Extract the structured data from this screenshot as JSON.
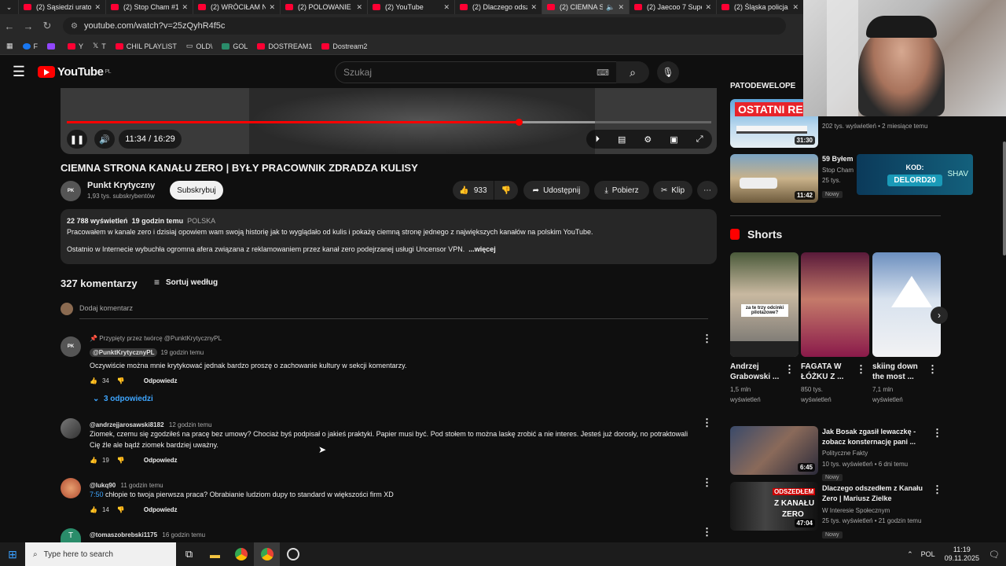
{
  "browser": {
    "tabs": [
      {
        "title": "(2) Sąsiedzi uratow",
        "active": false
      },
      {
        "title": "(2) Stop Cham #1",
        "active": false
      },
      {
        "title": "(2) WRÓCIŁAM N",
        "active": false
      },
      {
        "title": "(2) POLOWANIE N",
        "active": false
      },
      {
        "title": "(2) YouTube",
        "active": false
      },
      {
        "title": "(2) Dlaczego odsz",
        "active": false
      },
      {
        "title": "(2) CIEMNA S",
        "active": true
      },
      {
        "title": "(2) Jaecoo 7 Supe",
        "active": false
      },
      {
        "title": "(2) Śląska policja",
        "active": false
      }
    ],
    "url": "youtube.com/watch?v=25zQyhR4f5c",
    "bookmarks": [
      "F",
      "Y",
      "T",
      "CHIL PLAYLIST",
      "OLD\\",
      "GOL",
      "DOSTREAM1",
      "Dostream2"
    ]
  },
  "youtube": {
    "logo_text": "YouTube",
    "logo_region": "PL",
    "search_placeholder": "Szukaj"
  },
  "player": {
    "time": "11:34 / 16:29",
    "progress_fraction": 0.7016,
    "buffered_fraction": 0.82
  },
  "video": {
    "title": "CIEMNA STRONA KANAŁU ZERO | BYŁY PRACOWNIK ZDRADZA KULISY",
    "channel": "Punkt Krytyczny",
    "subscribers": "1,93 tys. subskrybentów",
    "subscribe_label": "Subskrybuj",
    "likes": "933",
    "share_label": "Udostępnij",
    "download_label": "Pobierz",
    "clip_label": "Klip",
    "views": "22 788 wyświetleń",
    "published": "19 godzin temu",
    "country_tag": "POLSKA",
    "desc_line1": "Pracowałem w kanale zero i dzisiaj opowiem wam swoją historię jak to wyglądało od kulis i pokażę ciemną stronę jednego z największych kanałów na polskim YouTube.",
    "desc_line2": "Ostatnio w Internecie wybuchła ogromna afera związana z reklamowaniem przez kanał zero podejrzanej usługi Uncensor VPN.",
    "more_label": "...więcej"
  },
  "comments": {
    "count": "327 komentarzy",
    "sort_label": "Sortuj według",
    "add_placeholder": "Dodaj komentarz",
    "items": [
      {
        "pinned": "Przypięty przez twórcę @PunktKrytycznyPL",
        "user": "@PunktKrytycznyPL",
        "time": "19 godzin temu",
        "text": "Oczywiście można mnie krytykować jednak bardzo proszę o zachowanie kultury w sekcji komentarzy.",
        "likes": "34",
        "reply_label": "Odpowiedz",
        "replies_label": "3 odpowiedzi"
      },
      {
        "user": "@andrzejjarosawski8182",
        "time": "12 godzin temu",
        "text1": "Ziomek, czemu się zgodziłeś na pracę bez umowy? Chociaż byś podpisał o jakieś praktyki. Papier musi być. Pod stołem to można laskę zrobić a nie interes. Jesteś już dorosły, no potraktowali",
        "text2": "Cię źle ale bądź ziomek bardziej uważny.",
        "likes": "19",
        "reply_label": "Odpowiedz"
      },
      {
        "user": "@lukq90",
        "time": "11 godzin temu",
        "timestamp_link": "7:50",
        "text": "chłopie to twoja pierwsza praca? Obrabianie ludziom dupy to standard w większości firm XD",
        "likes": "14",
        "reply_label": "Odpowiedz"
      },
      {
        "user": "@tomaszobrebski1175",
        "time": "16 godzin temu",
        "avatar_letter": "T"
      }
    ]
  },
  "sidebar": {
    "partial_heading": "PATODEWELOPE",
    "top_videos": [
      {
        "thumb_text": "OSTATNI RE",
        "duration": "31:30",
        "stats": "202 tys. wyświetleń • 2 miesiące temu"
      },
      {
        "title": "59 Byłem",
        "channel": "Stop Cham",
        "stats": "25 tys.",
        "duration": "11:42",
        "badge": "Nowy"
      }
    ],
    "shorts_heading": "Shorts",
    "shorts": [
      {
        "title1": "Andrzej",
        "title2": "Grabowski ...",
        "views": "1,5 mln",
        "views2": "wyświetleń",
        "caption": "za te trzy odcinki pilotażowe?"
      },
      {
        "title1": "FAGATA W",
        "title2": "ŁÓŻKU Z ...",
        "views": "850 tys.",
        "views2": "wyświetleń"
      },
      {
        "title1": "skiing down",
        "title2": "the most ...",
        "views": "7,1 mln",
        "views2": "wyświetleń"
      }
    ],
    "videos": [
      {
        "title1": "Jak Bosak zgasił lewaczkę -",
        "title2": "zobacz konsternację pani ...",
        "channel": "Polityczne Fakty",
        "stats": "10 tys. wyświetleń • 6 dni temu",
        "badge": "Nowy",
        "duration": "6:45"
      },
      {
        "title1": "Dlaczego odszedłem z Kanału",
        "title2": "Zero | Mariusz Zielke",
        "channel": "W Interesie Społecznym",
        "stats": "25 tys. wyświetleń • 21 godzin temu",
        "badge": "Nowy",
        "duration": "47:04",
        "thumb_text1": "ODSZEDŁEM",
        "thumb_text2": "Z KANAŁU",
        "thumb_text3": "ZERO"
      }
    ]
  },
  "overlay": {
    "code_label": "KOD:",
    "code_value": "DELORD20",
    "brand": "SHAV"
  },
  "taskbar": {
    "search_placeholder": "Type here to search",
    "lang": "POL",
    "time": "11:19",
    "date": "09.11.2025"
  },
  "colors": {
    "accent": "#ff0000",
    "background": "#0f0f0f",
    "pill": "#272727",
    "link": "#3ea6ff"
  }
}
